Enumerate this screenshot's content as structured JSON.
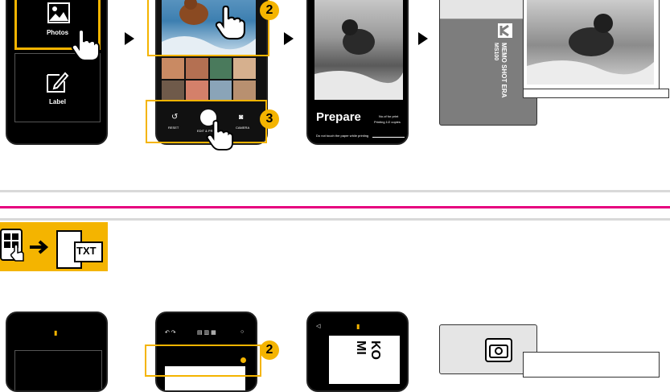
{
  "top_steps": {
    "photos_label": "Photos",
    "label_label": "Label",
    "step2_badge": "2",
    "step3_badge": "3",
    "reset_label": "RESET",
    "edit_print_label": "EDIT & PRINT",
    "camera_label": "CAMERA",
    "prepare_title": "Prepare",
    "prepare_count": "No.of for print",
    "prepare_copies": "Printing 1/2 copies",
    "prepare_note": "Do not touch the paper while printing",
    "printer_brand": "Kodak",
    "printer_model": "MEMO SHOT ERA",
    "printer_code": "MS100"
  },
  "divider": {
    "accent": "#e6007e",
    "rule": "#d9d9d9"
  },
  "bottom_steps": {
    "txt_label": "TXT",
    "step2_badge": "2",
    "rotated_text_1": "KO",
    "rotated_text_2": "MI"
  },
  "colors": {
    "yellow": "#f4b400",
    "phone": "#000000"
  }
}
